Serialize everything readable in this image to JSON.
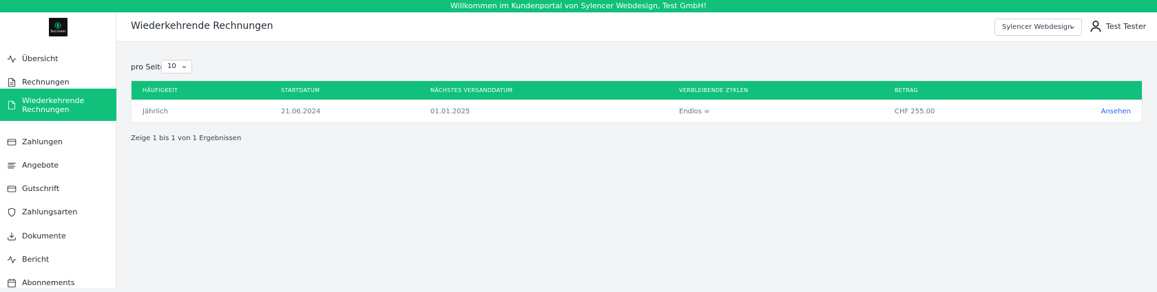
{
  "banner": {
    "text": "Willkommen im Kundenportal von Sylencer Webdesign, Test GmbH!"
  },
  "logo": {
    "text": "Test GmbH"
  },
  "sidebar": {
    "items": [
      {
        "label": "Übersicht",
        "icon": "activity-icon",
        "active": false
      },
      {
        "label": "Rechnungen",
        "icon": "document-icon",
        "active": false
      },
      {
        "label": "Wiederkehrende Rechnungen",
        "icon": "file-icon",
        "active": true
      },
      {
        "label": "Zahlungen",
        "icon": "credit-card-icon",
        "active": false
      },
      {
        "label": "Angebote",
        "icon": "align-left-icon",
        "active": false
      },
      {
        "label": "Gutschrift",
        "icon": "credit-card-icon",
        "active": false
      },
      {
        "label": "Zahlungsarten",
        "icon": "shield-icon",
        "active": false
      },
      {
        "label": "Dokumente",
        "icon": "download-icon",
        "active": false
      },
      {
        "label": "Bericht",
        "icon": "activity-icon",
        "active": false
      },
      {
        "label": "Abonnements",
        "icon": "calendar-icon",
        "active": false
      }
    ]
  },
  "header": {
    "title": "Wiederkehrende Rechnungen",
    "company_select": "Sylencer Webdesign",
    "user_name": "Test Tester"
  },
  "pagination": {
    "per_page_label": "pro Seite",
    "per_page_value": "10",
    "results_text": "Zeige 1 bis 1 von 1 Ergebnissen"
  },
  "table": {
    "headers": [
      "HÄUFIGKEIT",
      "STARTDATUM",
      "NÄCHSTES VERSANDDATUM",
      "VERBLEIBENDE ZYKLEN",
      "BETRAG"
    ],
    "rows": [
      {
        "cells": [
          "Jährlich",
          "21.06.2024",
          "01.01.2025",
          "Endlos ∞",
          "CHF 255.00"
        ],
        "action": "Ansehen"
      }
    ]
  },
  "colors": {
    "accent": "#10c07b",
    "link": "#2563eb",
    "background": "#f3f4f6"
  }
}
